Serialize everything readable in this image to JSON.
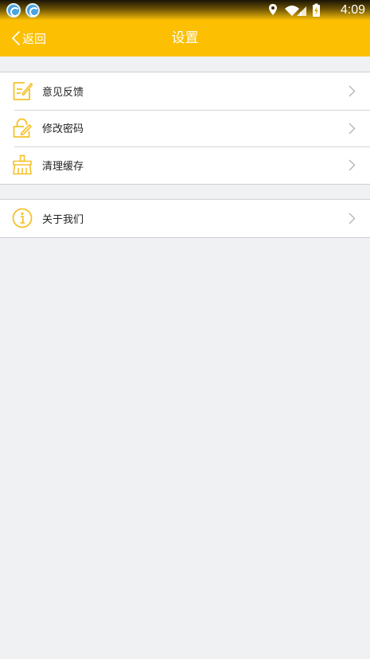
{
  "status_bar": {
    "time": "4:09",
    "icons": [
      "app-notification-icon",
      "app-notification-icon",
      "location-icon",
      "wifi-icon",
      "signal-icon",
      "battery-charging-icon"
    ]
  },
  "header": {
    "back_label": "返回",
    "title": "设置"
  },
  "settings_groups": [
    {
      "items": [
        {
          "label": "意见反馈",
          "icon": "feedback-edit-icon"
        },
        {
          "label": "修改密码",
          "icon": "lock-edit-icon"
        },
        {
          "label": "清理缓存",
          "icon": "broom-icon"
        }
      ]
    },
    {
      "items": [
        {
          "label": "关于我们",
          "icon": "info-icon"
        }
      ]
    }
  ],
  "colors": {
    "accent": "#fcbf02",
    "background": "#f0f1f3",
    "icon": "#f5c12a",
    "chevron": "#b9babd",
    "text": "#222222"
  }
}
